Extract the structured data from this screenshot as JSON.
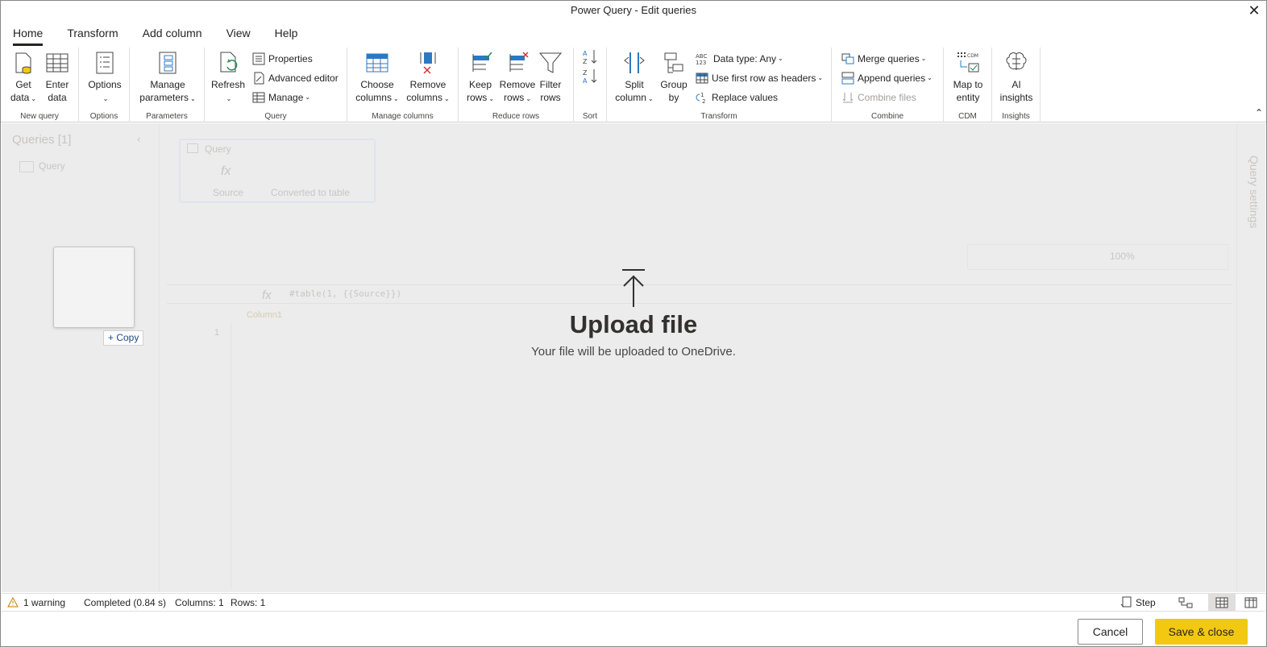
{
  "window": {
    "title": "Power Query - Edit queries",
    "close_glyph": "✕"
  },
  "tabs": [
    {
      "label": "Home",
      "active": true
    },
    {
      "label": "Transform"
    },
    {
      "label": "Add column"
    },
    {
      "label": "View"
    },
    {
      "label": "Help"
    }
  ],
  "ribbon": {
    "new_query": {
      "label": "New query",
      "get_data": "Get data",
      "enter_data": "Enter data"
    },
    "options": {
      "label": "Options",
      "options_btn": "Options"
    },
    "parameters": {
      "label": "Parameters",
      "manage_params": "Manage parameters"
    },
    "query": {
      "label": "Query",
      "refresh": "Refresh",
      "properties": "Properties",
      "advanced_editor": "Advanced editor",
      "manage": "Manage"
    },
    "manage_columns": {
      "label": "Manage columns",
      "choose": "Choose columns",
      "remove": "Remove columns"
    },
    "reduce_rows": {
      "label": "Reduce rows",
      "keep": "Keep rows",
      "remove": "Remove rows",
      "filter": "Filter rows"
    },
    "sort": {
      "label": "Sort"
    },
    "transform": {
      "label": "Transform",
      "split": "Split column",
      "group": "Group by",
      "data_type": "Data type: Any",
      "first_row": "Use first row as headers",
      "replace": "Replace values"
    },
    "combine": {
      "label": "Combine",
      "merge": "Merge queries",
      "append": "Append queries",
      "combine_files": "Combine files"
    },
    "cdm": {
      "label": "CDM",
      "map": "Map to entity"
    },
    "insights": {
      "label": "Insights",
      "ai": "AI insights"
    }
  },
  "background": {
    "queries_title": "Queries [1]",
    "query_item": "Query",
    "diagram_title": "Query",
    "step_source": "Source",
    "step_converted": "Converted to table",
    "formula": "#table(1, {{Source}})",
    "column_header": "Column1",
    "row_number": "1",
    "zoom": "100%",
    "query_settings": "Query settings"
  },
  "upload": {
    "title": "Upload file",
    "subtitle": "Your file will be uploaded to OneDrive.",
    "copy_label": "+ Copy"
  },
  "status": {
    "warning": "1 warning",
    "completed": "Completed (0.84 s)",
    "columns": "Columns: 1",
    "rows": "Rows: 1",
    "step": "Step"
  },
  "footer": {
    "cancel": "Cancel",
    "save": "Save & close"
  },
  "colors": {
    "accent": "#f2c811",
    "overlay": "#ececec",
    "icon_blue": "#2b79c2"
  }
}
